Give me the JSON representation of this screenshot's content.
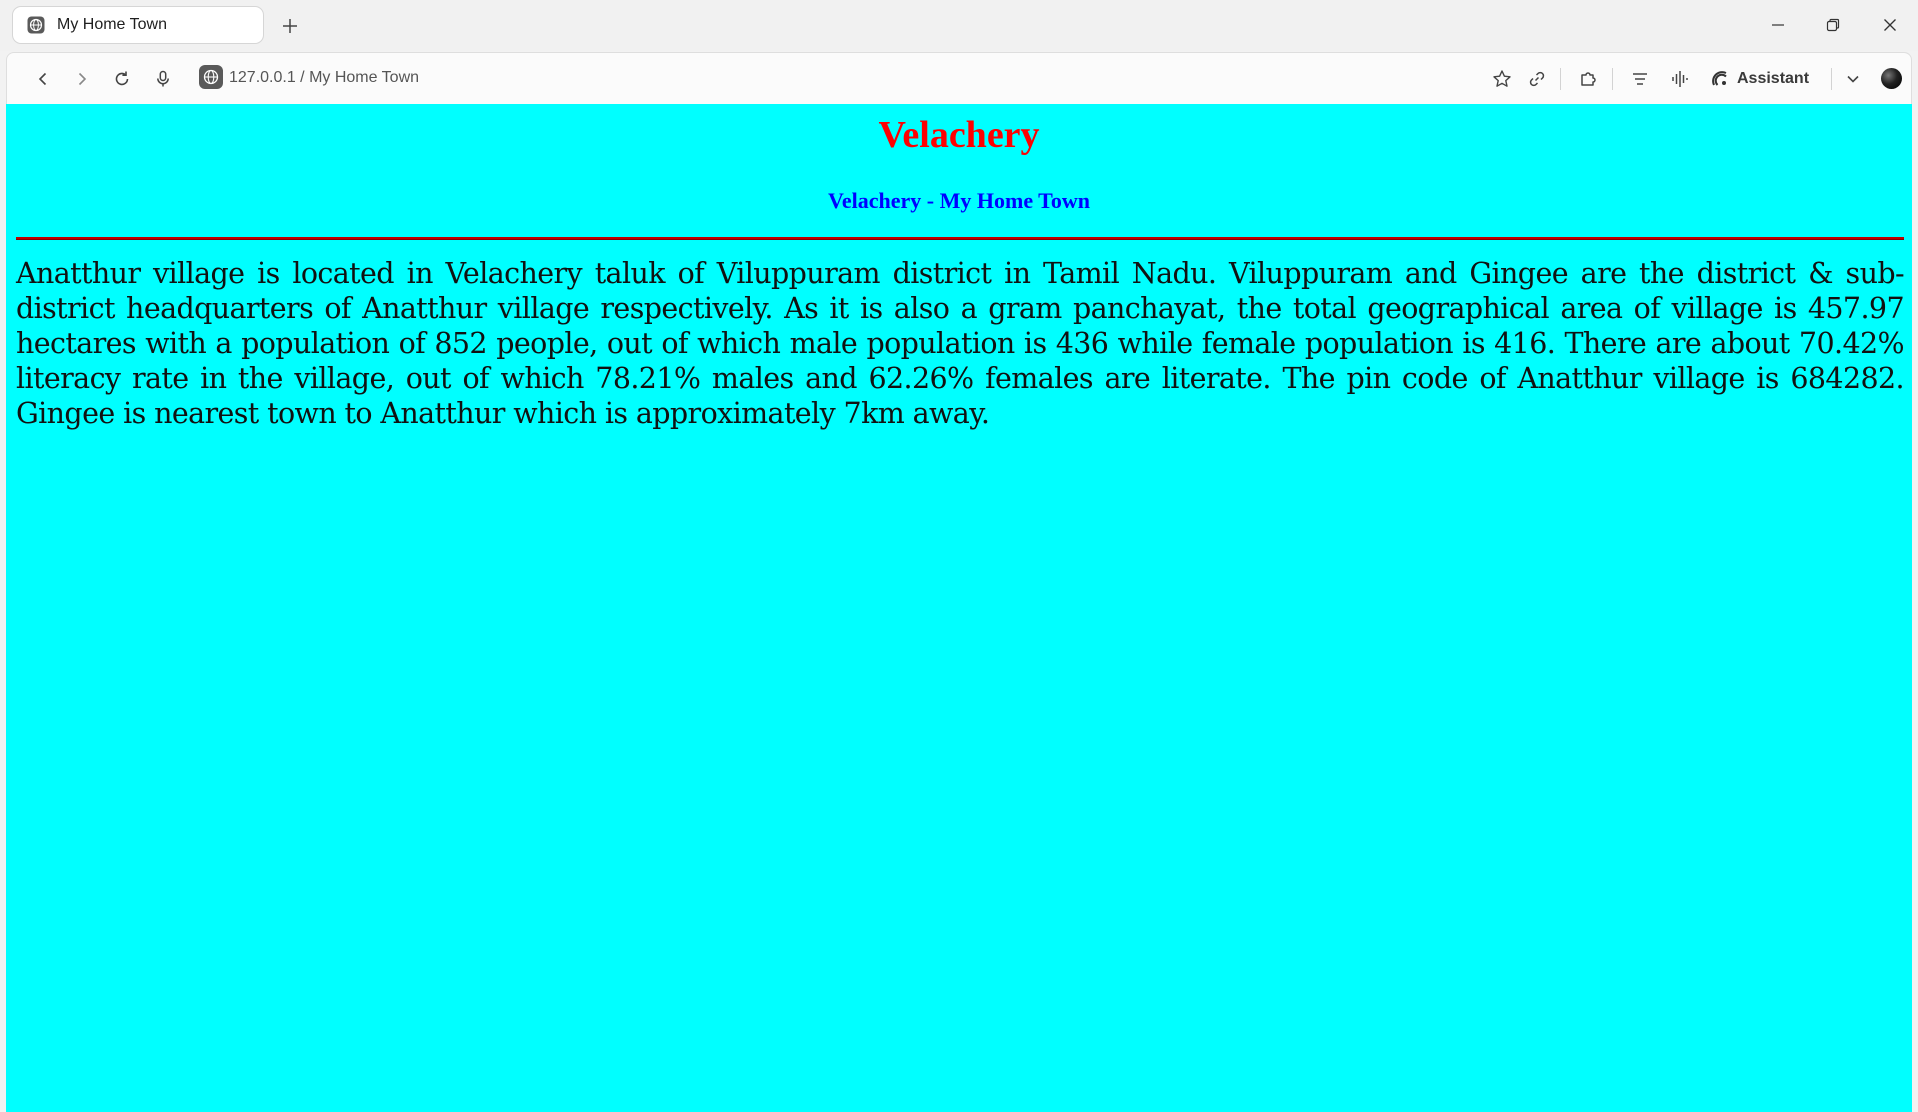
{
  "browser": {
    "tab": {
      "title": "My Home Town",
      "icon": "globe-icon"
    },
    "new_tab_icon": "plus-icon",
    "address": {
      "url": "127.0.0.1 / My Home Town",
      "site_icon": "globe-icon"
    },
    "assistant_label": "Assistant",
    "icons": [
      "back-icon",
      "forward-icon",
      "reload-icon",
      "microphone-icon",
      "star-icon",
      "link-icon",
      "extensions-icon",
      "reader-icon",
      "audio-icon",
      "assistant-icon",
      "chevron-down-icon",
      "profile-icon",
      "minimize-icon",
      "restore-icon",
      "close-icon"
    ]
  },
  "page": {
    "heading": "Velachery",
    "subheading": "Velachery - My Home Town",
    "paragraph": "Anatthur village is located in Velachery taluk of Viluppuram district in Tamil Nadu. Viluppuram and Gingee are the district & sub-district headquarters of Anatthur village respectively. As it is also a gram panchayat, the total geographical area of village is 457.97 hectares with a population of 852 people, out of which male population is 436 while female population is 416. There are about 70.42% literacy rate in the village, out of which 78.21% males and 62.26% females are literate. The pin code of Anatthur village is 684282. Gingee is nearest town to Anatthur which is approximately 7km away.",
    "colors": {
      "background": "#00ffff",
      "heading": "#ff0000",
      "subheading": "#0000ff",
      "rule": "#c00000"
    }
  }
}
